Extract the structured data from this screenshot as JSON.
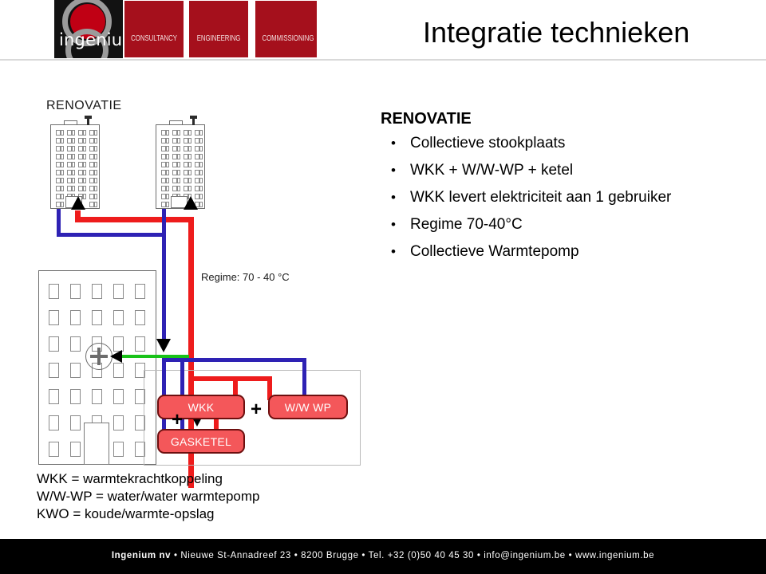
{
  "header": {
    "logo_word": "ingenium",
    "tabs": [
      "CONSULTANCY",
      "ENGINEERING",
      "COMMISSIONING"
    ],
    "title": "Integratie technieken"
  },
  "bullets": {
    "heading": "RENOVATIE",
    "items": [
      "Collectieve stookplaats",
      "WKK + W/W-WP + ketel",
      "WKK levert elektriciteit aan 1 gebruiker",
      "Regime 70-40°C",
      "Collectieve Warmtepomp"
    ]
  },
  "diagram": {
    "label": "RENOVATIE",
    "regime_label": "Regime: 70 - 40 °C",
    "units": [
      {
        "name": "WKK"
      },
      {
        "name": "W/W WP"
      },
      {
        "name": "GASKETEL"
      }
    ],
    "plus_signs": [
      "+",
      "+"
    ],
    "colors": {
      "supply_pipe": "#ee1c1c",
      "return_pipe": "#2e22b4",
      "electricity_pipe": "#19c219",
      "unit_fill": "#f4575a",
      "unit_border": "#6d0f0f"
    }
  },
  "legend": {
    "lines": [
      "WKK = warmtekrachtkoppeling",
      "W/W-WP = water/water warmtepomp",
      "KWO = koude/warmte-opslag"
    ]
  },
  "footer": {
    "company": "Ingenium nv",
    "address": "Nieuwe St-Annadreef  23",
    "city": "8200 Brugge",
    "tel": "Tel. +32 (0)50 40 45 30",
    "email": "info@ingenium.be",
    "web": "www.ingenium.be",
    "separator": "•"
  }
}
